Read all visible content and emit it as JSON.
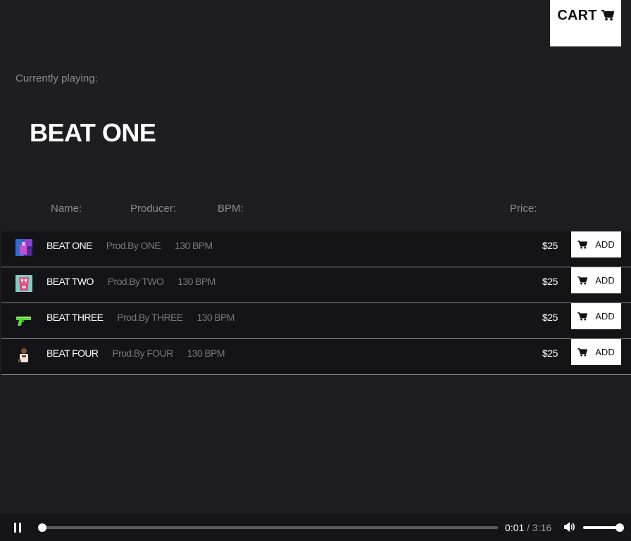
{
  "cart": {
    "label": "CART",
    "icon": "cart-icon"
  },
  "now_playing": {
    "label": "Currently playing:",
    "title": "BEAT ONE"
  },
  "table": {
    "headers": {
      "name": "Name:",
      "producer": "Producer:",
      "bpm": "BPM:",
      "price": "Price:"
    },
    "tracks": [
      {
        "name": "BEAT ONE",
        "producer": "Prod.By ONE",
        "bpm": "130 BPM",
        "price": "$25",
        "add_label": "ADD",
        "thumbnail_icon": "purple-scene-thumbnail"
      },
      {
        "name": "BEAT TWO",
        "producer": "Prod.By TWO",
        "bpm": "130 BPM",
        "price": "$25",
        "add_label": "ADD",
        "thumbnail_icon": "pink-character-thumbnail"
      },
      {
        "name": "BEAT THREE",
        "producer": "Prod.By THREE",
        "bpm": "130 BPM",
        "price": "$25",
        "add_label": "ADD",
        "thumbnail_icon": "green-pistol-thumbnail"
      },
      {
        "name": "BEAT FOUR",
        "producer": "Prod.By FOUR",
        "bpm": "130 BPM",
        "price": "$25",
        "add_label": "ADD",
        "thumbnail_icon": "person-photo-thumbnail"
      }
    ]
  },
  "player": {
    "state": "playing",
    "current_time": "0:01",
    "separator": "/",
    "total_time": "3:16",
    "progress_fraction": 0.005,
    "volume_fraction": 1.0
  },
  "colors": {
    "background": "#1e1d22",
    "row_background": "#141316",
    "player_background": "#151418",
    "muted_text": "#8b8a90",
    "accent": "#ffffff"
  }
}
